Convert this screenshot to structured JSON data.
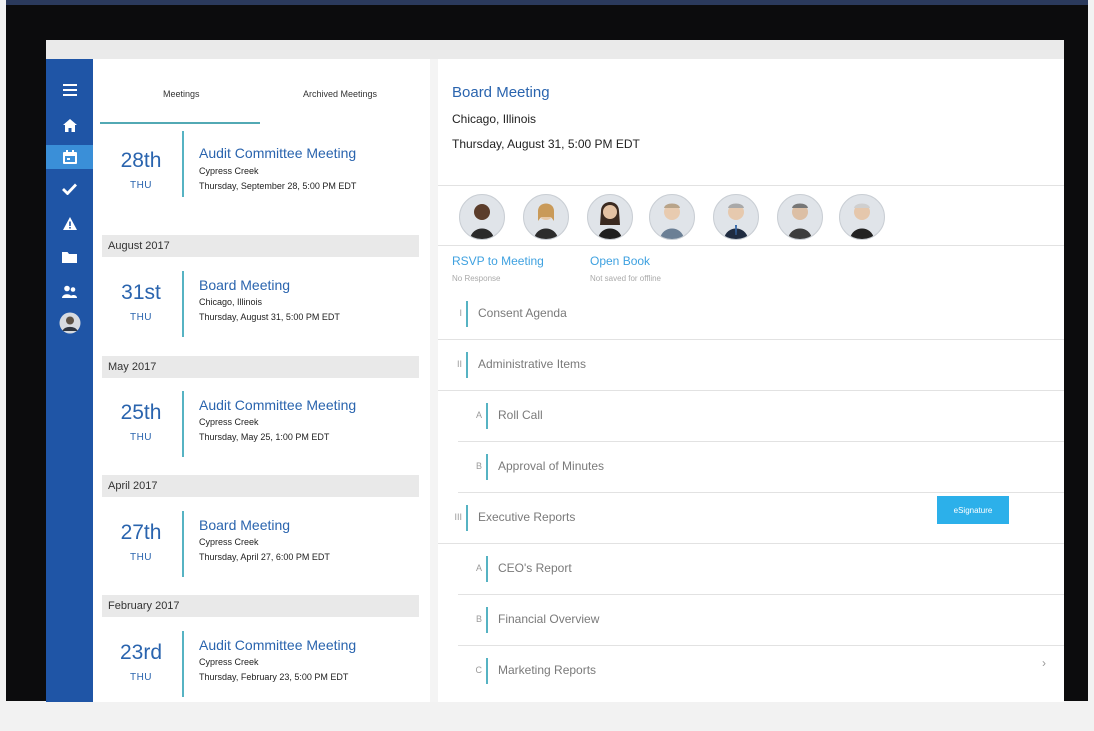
{
  "colors": {
    "sidebar": "#1f55a6",
    "sidebar_active": "#3a8fd8",
    "accent_teal": "#56b3c3",
    "link_blue": "#3ea1e0",
    "title_blue": "#2a64ae",
    "esign_button": "#2cb0ea"
  },
  "sidebar": {
    "items": [
      {
        "icon": "menu-icon",
        "active": false
      },
      {
        "icon": "home-icon",
        "active": false
      },
      {
        "icon": "calendar-icon",
        "active": true
      },
      {
        "icon": "checkmark-icon",
        "active": false
      },
      {
        "icon": "warning-icon",
        "active": false
      },
      {
        "icon": "folder-icon",
        "active": false
      },
      {
        "icon": "people-icon",
        "active": false
      },
      {
        "icon": "profile-avatar-icon",
        "active": false
      }
    ]
  },
  "tabs": {
    "meetings": "Meetings",
    "archived": "Archived Meetings"
  },
  "meetings": [
    {
      "day": "28th",
      "dow": "THU",
      "title": "Audit Committee Meeting",
      "location": "Cypress Creek",
      "datetime": "Thursday, September 28, 5:00 PM EDT"
    },
    {
      "day": "31st",
      "dow": "THU",
      "title": "Board Meeting",
      "location": "Chicago, Illinois",
      "datetime": "Thursday, August 31, 5:00 PM EDT"
    },
    {
      "day": "25th",
      "dow": "THU",
      "title": "Audit Committee Meeting",
      "location": "Cypress Creek",
      "datetime": "Thursday, May 25, 1:00 PM EDT"
    },
    {
      "day": "27th",
      "dow": "THU",
      "title": "Board Meeting",
      "location": "Cypress Creek",
      "datetime": "Thursday, April 27, 6:00 PM EDT"
    },
    {
      "day": "23rd",
      "dow": "THU",
      "title": "Audit Committee Meeting",
      "location": "Cypress Creek",
      "datetime": "Thursday, February 23, 5:00 PM EDT"
    }
  ],
  "month_headers": [
    "August 2017",
    "May 2017",
    "April 2017",
    "February 2017"
  ],
  "detail": {
    "title": "Board Meeting",
    "location": "Chicago, Illinois",
    "datetime": "Thursday, August 31, 5:00 PM EDT",
    "attendees": [
      "attendee-avatar",
      "attendee-avatar",
      "attendee-avatar",
      "attendee-avatar",
      "attendee-avatar",
      "attendee-avatar",
      "attendee-avatar"
    ],
    "rsvp": {
      "label": "RSVP to Meeting",
      "sub": "No Response"
    },
    "open_book": {
      "label": "Open Book",
      "sub": "Not saved for offline"
    },
    "agenda": [
      {
        "num": "I",
        "label": "Consent Agenda",
        "level": 0
      },
      {
        "num": "II",
        "label": "Administrative Items",
        "level": 0
      },
      {
        "num": "A",
        "label": "Roll Call",
        "level": 1
      },
      {
        "num": "B",
        "label": "Approval of Minutes",
        "level": 1
      },
      {
        "num": "III",
        "label": "Executive Reports",
        "level": 0
      },
      {
        "num": "A",
        "label": "CEO's Report",
        "level": 1
      },
      {
        "num": "B",
        "label": "Financial Overview",
        "level": 1
      },
      {
        "num": "C",
        "label": "Marketing Reports",
        "level": 1
      }
    ],
    "esignature_label": "eSignature",
    "chevron": "›"
  }
}
